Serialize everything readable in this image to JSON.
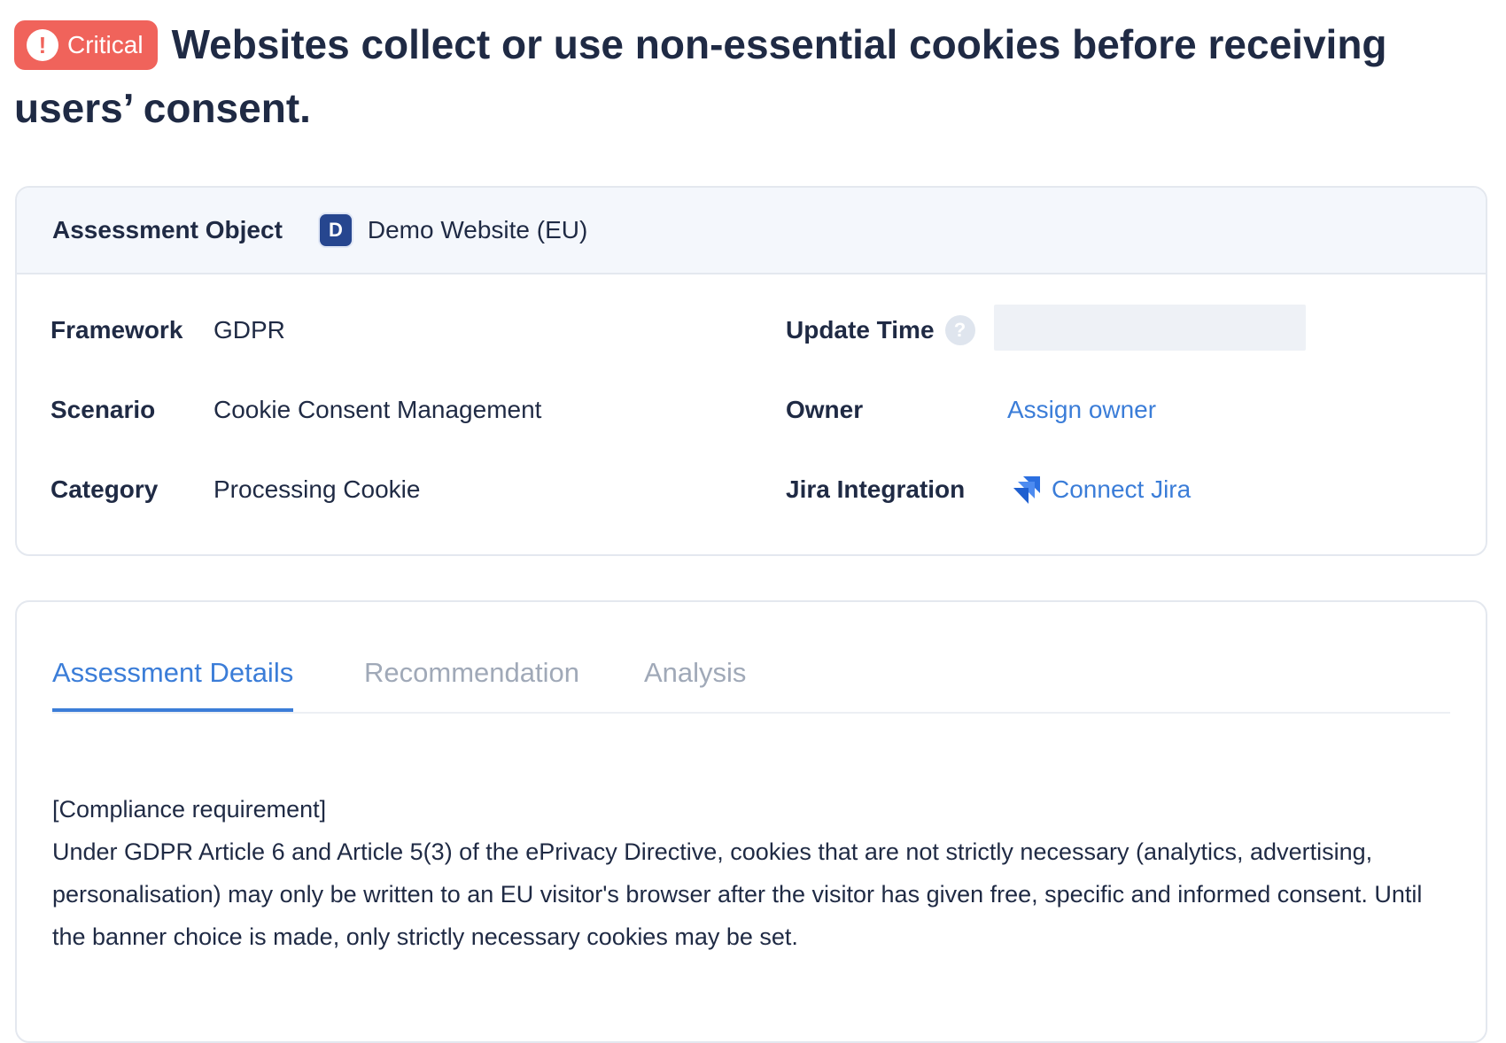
{
  "header": {
    "severity": "Critical",
    "severity_color": "#f0635b",
    "severity_icon": "exclamation-circle-icon",
    "title": "Websites collect or use non-essential cookies before receiving users’ consent."
  },
  "assessment_object": {
    "label": "Assessment Object",
    "avatar_letter": "D",
    "value": "Demo Website (EU)"
  },
  "fields": {
    "framework": {
      "label": "Framework",
      "value": "GDPR"
    },
    "scenario": {
      "label": "Scenario",
      "value": "Cookie Consent Management"
    },
    "category": {
      "label": "Category",
      "value": "Processing Cookie"
    },
    "update_time": {
      "label": "Update Time",
      "help_icon": "?",
      "value": ""
    },
    "owner": {
      "label": "Owner",
      "action": "Assign owner"
    },
    "jira": {
      "label": "Jira Integration",
      "action": "Connect Jira",
      "icon": "jira-icon"
    }
  },
  "tabs": [
    {
      "label": "Assessment Details",
      "active": true
    },
    {
      "label": "Recommendation",
      "active": false
    },
    {
      "label": "Analysis",
      "active": false
    }
  ],
  "details": {
    "heading": "[Compliance requirement]",
    "body": "Under GDPR Article 6 and Article 5(3) of the ePrivacy Directive, cookies that are not strictly necessary (analytics, advertising, personalisation) may only be written to an EU visitor's browser after the visitor has given free, specific and informed consent. Until the banner choice is made, only strictly necessary cookies may be set."
  },
  "colors": {
    "accent": "#3b7dd8",
    "text": "#1f2a44",
    "muted_tab": "#a0a9b8",
    "avatar_bg": "#26468f"
  }
}
